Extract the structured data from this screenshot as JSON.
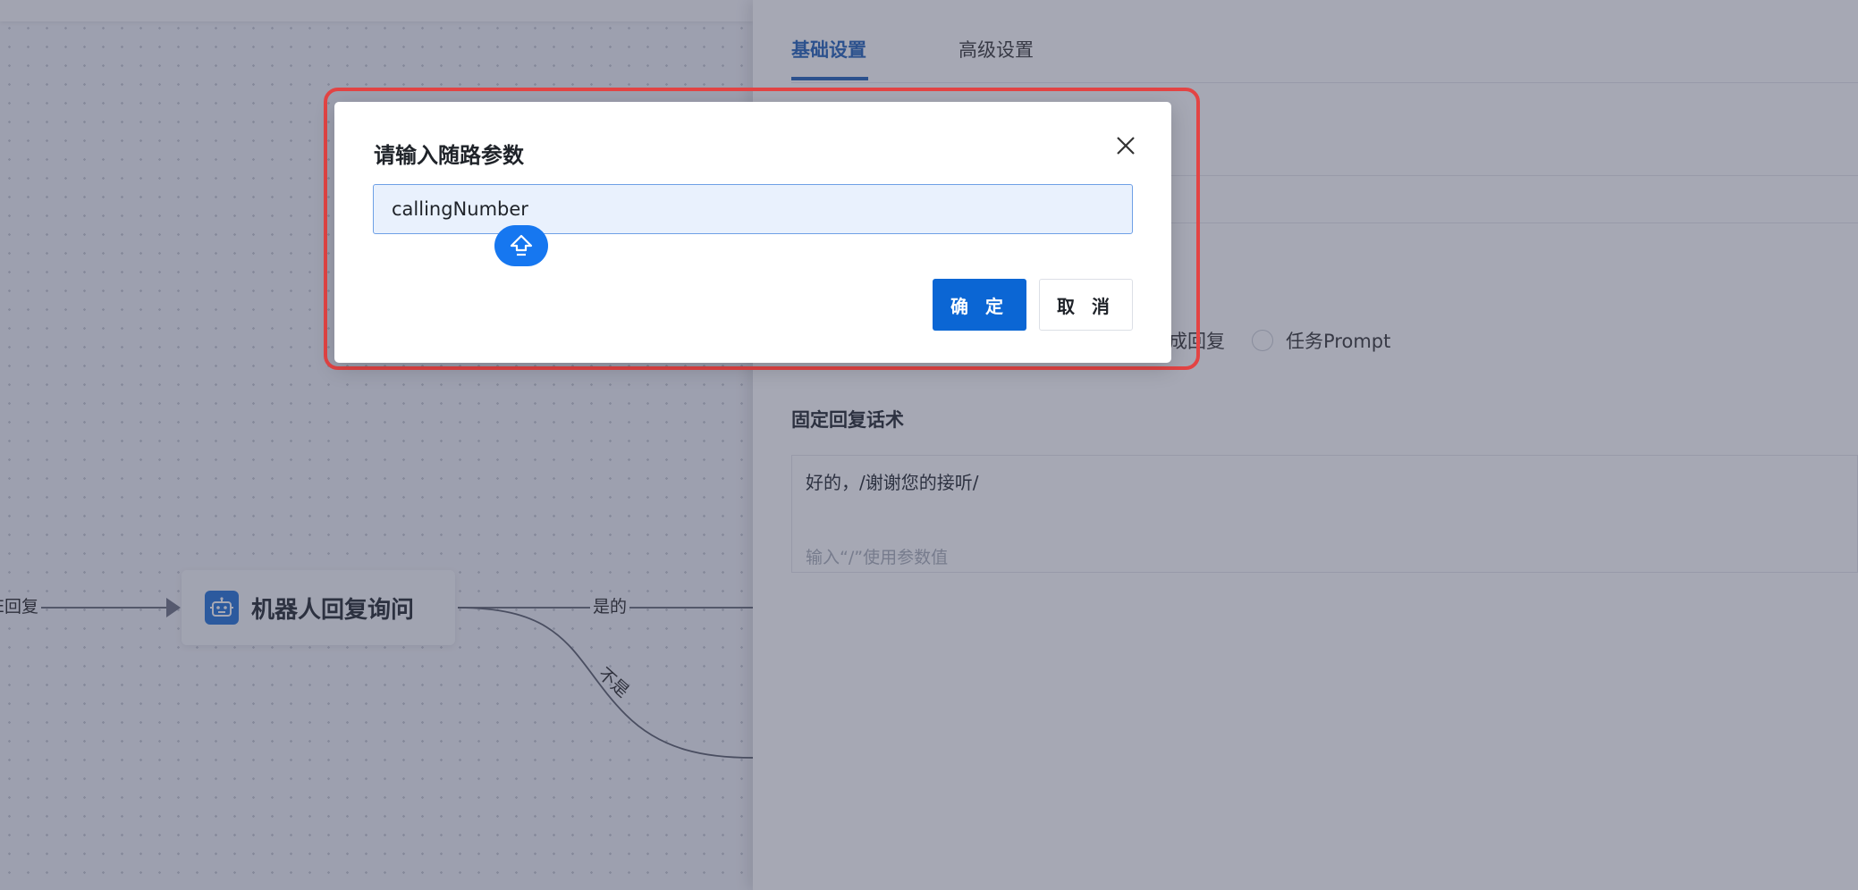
{
  "canvas": {
    "edge_left_label": "E回复",
    "node_title": "机器人回复询问",
    "node_icon": "robot-icon",
    "edge_yes_label": "是的",
    "edge_no_label": "不是"
  },
  "panel": {
    "tabs": [
      {
        "label": "基础设置",
        "active": true
      },
      {
        "label": "高级设置",
        "active": false
      }
    ],
    "reply_type_options": [
      "成回复",
      "任务Prompt"
    ],
    "section_title": "固定回复话术",
    "reply_text": "好的，/谢谢您的接听/",
    "reply_placeholder": "输入“/”使用参数值"
  },
  "modal": {
    "title": "请输入随路参数",
    "input_value": "callingNumber",
    "shift_icon": "shift-arrow-icon",
    "confirm_label": "确 定",
    "cancel_label": "取 消",
    "close_icon": "close-icon"
  },
  "colors": {
    "primary": "#0b66d4",
    "tab_active": "#1f5fb8",
    "highlight": "#e34444",
    "input_bg": "#e9f1fd"
  }
}
